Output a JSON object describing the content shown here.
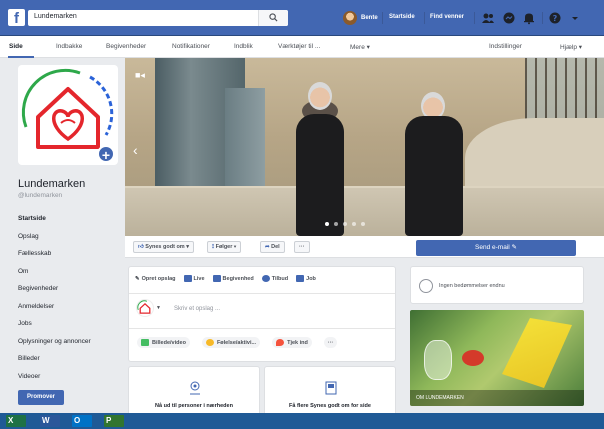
{
  "topbar": {
    "logo_letter": "f",
    "search_value": "Lundemarken",
    "user_name": "Bente",
    "link_home": "Startside",
    "link_find_friends": "Find venner"
  },
  "subnav": {
    "tabs": [
      "Side",
      "Indbakke",
      "Begivenheder",
      "Notifikationer",
      "Indblik",
      "Værktøjer til ...",
      "Mere ▾"
    ],
    "settings": "Indstillinger",
    "help": "Hjælp ▾"
  },
  "profile": {
    "name": "Lundemarken",
    "handle": "@lundemarken",
    "plus": "+"
  },
  "left_menu": [
    "Startside",
    "Opslag",
    "Fællesskab",
    "Om",
    "Begivenheder",
    "Anmeldelser",
    "Jobs",
    "Oplysninger og annoncer",
    "Billeder",
    "Videoer"
  ],
  "promote_label": "Promover",
  "actions": {
    "like": "Synes godt om ▾",
    "follow": "Følger ▾",
    "share": "Del",
    "more": "···",
    "send_email": "Send e-mail ✎"
  },
  "composer": {
    "top": [
      "Opret opslag",
      "Live",
      "Begivenhed",
      "Tilbud",
      "Job"
    ],
    "placeholder": "Skriv et opslag ...",
    "bottom": [
      "Billede/video",
      "Følelse/aktivi...",
      "Tjek ind",
      "···"
    ]
  },
  "cards": [
    {
      "text": "Nå ud til personer i nærheden"
    },
    {
      "text": "Få flere Synes godt om for side"
    }
  ],
  "reviews_text": "Ingen bedømmelser endnu",
  "photo_label": "OM LUNDEMARKEN",
  "taskbar": [
    "X",
    "W",
    "O",
    "P"
  ],
  "colors": {
    "brand": "#4267b2",
    "logo_red": "#e4262c",
    "logo_green": "#2ea84a",
    "logo_blue": "#2b63d8"
  }
}
